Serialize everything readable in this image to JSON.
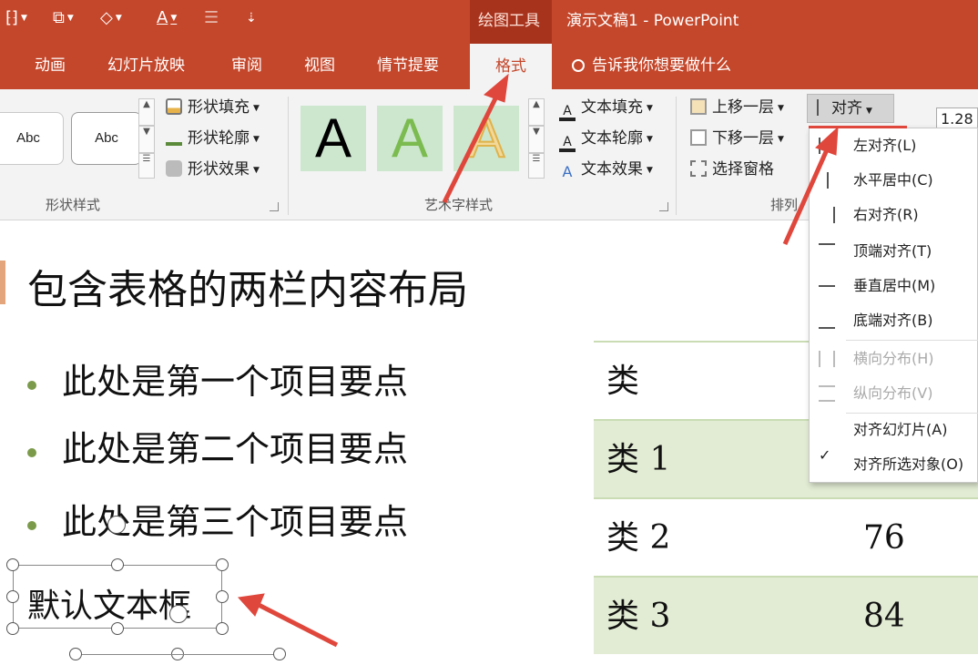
{
  "titlebar": {
    "context_group": "绘图工具",
    "document_title": "演示文稿1 - PowerPoint"
  },
  "tabs": {
    "items": [
      "动画",
      "幻灯片放映",
      "审阅",
      "视图",
      "情节提要"
    ],
    "active": "格式",
    "tell_me": "告诉我你想要做什么"
  },
  "ribbon": {
    "shape_styles": {
      "sample1": "Abc",
      "sample2": "Abc",
      "fill": "形状填充",
      "outline": "形状轮廓",
      "effects": "形状效果",
      "label": "形状样式"
    },
    "wordart": {
      "tile1": "A",
      "tile2": "A",
      "tile3": "A",
      "text_fill": "文本填充",
      "text_outline": "文本轮廓",
      "text_effects": "文本效果",
      "label": "艺术字样式"
    },
    "arrange": {
      "bring_forward": "上移一层",
      "send_backward": "下移一层",
      "selection_pane": "选择窗格",
      "align": "对齐",
      "label": "排列"
    },
    "size_value": "1.28"
  },
  "align_menu": {
    "items": [
      {
        "label": "左对齐(L)",
        "enabled": true
      },
      {
        "label": "水平居中(C)",
        "enabled": true
      },
      {
        "label": "右对齐(R)",
        "enabled": true
      },
      {
        "label": "顶端对齐(T)",
        "enabled": true
      },
      {
        "label": "垂直居中(M)",
        "enabled": true
      },
      {
        "label": "底端对齐(B)",
        "enabled": true
      },
      {
        "label": "横向分布(H)",
        "enabled": false
      },
      {
        "label": "纵向分布(V)",
        "enabled": false
      },
      {
        "label": "对齐幻灯片(A)",
        "enabled": true
      },
      {
        "label": "对齐所选对象(O)",
        "enabled": true,
        "checked": true
      }
    ]
  },
  "slide": {
    "title": "包含表格的两栏内容布局",
    "bullets": [
      "此处是第一个项目要点",
      "此处是第二个项目要点",
      "此处是第三个项目要点"
    ],
    "textbox": "默认文本框",
    "table": {
      "header": "类",
      "rows": [
        {
          "label": "类 1",
          "value": ""
        },
        {
          "label": "类 2",
          "value": "76"
        },
        {
          "label": "类 3",
          "value": "84"
        }
      ]
    }
  },
  "colors": {
    "accent": "#c4472b",
    "context_tab": "#a8331d",
    "table_shade": "#e2ecd4",
    "arrow": "#e0473c"
  }
}
